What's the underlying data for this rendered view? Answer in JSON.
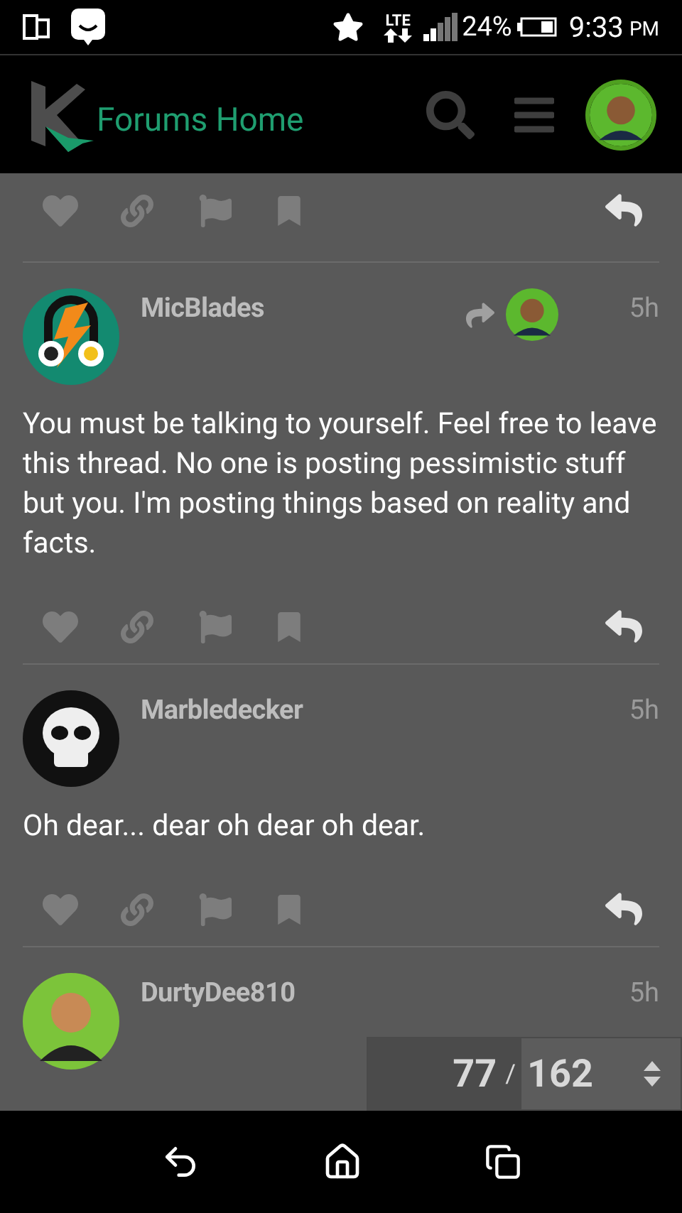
{
  "status_bar": {
    "network": "LTE",
    "battery": "24%",
    "time": "9:33",
    "meridiem": "PM"
  },
  "header": {
    "title": "Forums Home"
  },
  "posts": [
    {
      "author": "MicBlades",
      "time": "5h",
      "reply_to": true,
      "text": "You must be talking to yourself. Feel free to leave this thread. No one is posting pessimistic stuff but you. I'm posting things based on reality and facts.",
      "show_actions": true
    },
    {
      "author": "Marbledecker",
      "time": "5h",
      "reply_to": false,
      "text": "Oh dear... dear oh dear oh dear.",
      "show_actions": true
    },
    {
      "author": "DurtyDee810",
      "time": "5h",
      "reply_to": false,
      "show_actions": false
    }
  ],
  "timeline": {
    "current": "77",
    "separator": "/",
    "total": "162"
  }
}
